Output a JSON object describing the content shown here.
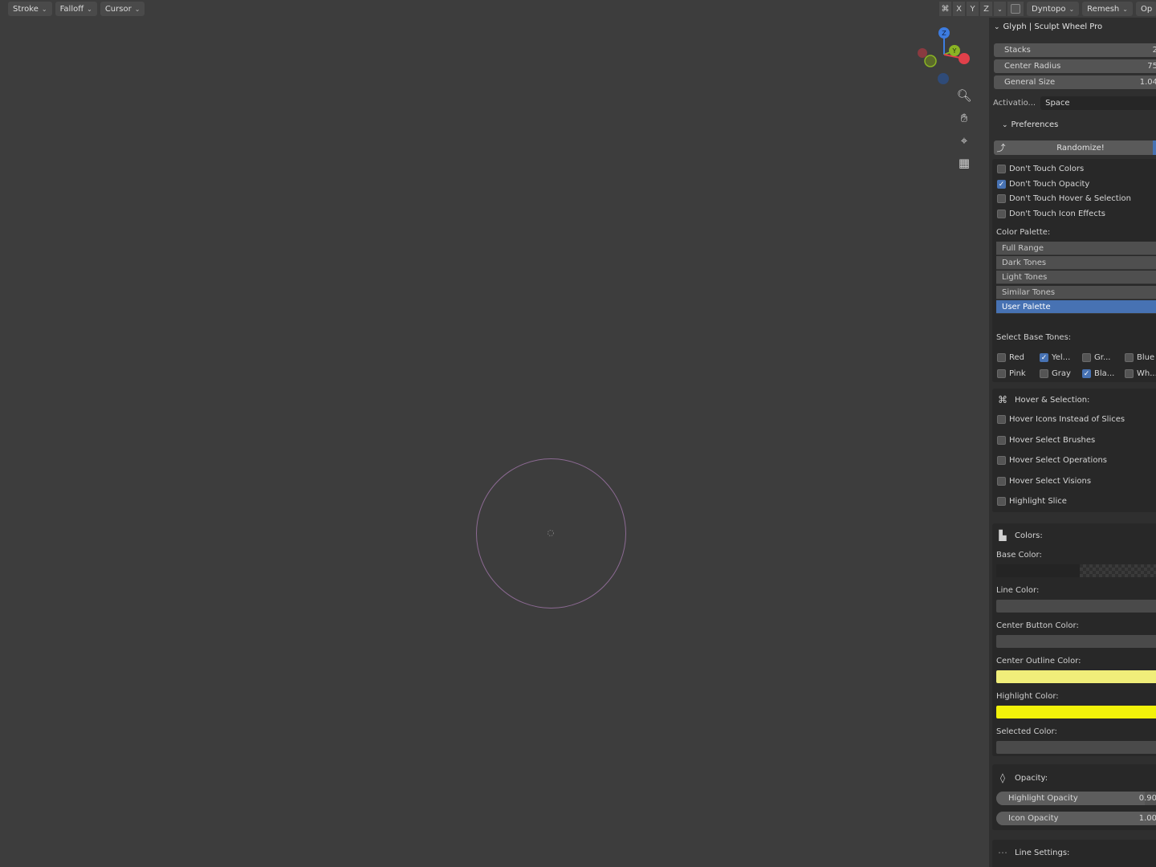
{
  "topbar": {
    "left_buttons": [
      "Stroke",
      "Falloff",
      "Cursor"
    ],
    "axes": [
      "X",
      "Y",
      "Z"
    ],
    "dyntopo": "Dyntopo",
    "remesh": "Remesh",
    "options_partial": "Op"
  },
  "gizmo": {
    "z": "Z",
    "y": "Y"
  },
  "panel": {
    "title": "Glyph | Sculpt Wheel Pro",
    "stacks": {
      "label": "Stacks",
      "value": "2"
    },
    "center_radius": {
      "label": "Center Radius",
      "value": "75"
    },
    "general_size": {
      "label": "General Size",
      "value": "1.04"
    },
    "activation": {
      "label": "Activatio...",
      "value": "Space"
    },
    "preferences": {
      "title": "Preferences",
      "randomize_label": "Randomize!",
      "checks": [
        {
          "label": "Don't Touch Colors",
          "checked": false
        },
        {
          "label": "Don't Touch Opacity",
          "checked": true
        },
        {
          "label": "Don't Touch Hover & Selection",
          "checked": false
        },
        {
          "label": "Don't Touch Icon Effects",
          "checked": false
        }
      ],
      "color_palette_label": "Color Palette:",
      "palette_options": [
        "Full Range",
        "Dark Tones",
        "Light Tones",
        "Similar Tones",
        "User Palette"
      ],
      "palette_selected": "User Palette",
      "base_tones_label": "Select Base Tones:",
      "tones_row1": [
        {
          "label": "Red",
          "checked": false
        },
        {
          "label": "Yel...",
          "checked": true
        },
        {
          "label": "Gr...",
          "checked": false
        },
        {
          "label": "Blue",
          "checked": false
        }
      ],
      "tones_row2": [
        {
          "label": "Pink",
          "checked": false
        },
        {
          "label": "Gray",
          "checked": false
        },
        {
          "label": "Bla...",
          "checked": true
        },
        {
          "label": "Wh...",
          "checked": false
        }
      ]
    },
    "hover": {
      "title": "Hover & Selection:",
      "checks": [
        {
          "label": "Hover Icons Instead of Slices",
          "checked": false
        },
        {
          "label": "Hover Select Brushes",
          "checked": false
        },
        {
          "label": "Hover Select Operations",
          "checked": false
        },
        {
          "label": "Hover Select Visions",
          "checked": false
        },
        {
          "label": "Highlight Slice",
          "checked": false
        }
      ]
    },
    "colors": {
      "title": "Colors:",
      "base_color_label": "Base Color:",
      "line_color_label": "Line Color:",
      "center_button_color_label": "Center Button Color:",
      "center_outline_color_label": "Center Outline Color:",
      "highlight_color_label": "Highlight Color:",
      "selected_color_label": "Selected Color:",
      "line_color": "#4a4a4a",
      "center_button_color": "#4a4a4a",
      "center_outline_color": "#f0ee7a",
      "highlight_color": "#f2f20a",
      "selected_color": "#4a4a4a"
    },
    "opacity": {
      "title": "Opacity:",
      "highlight": {
        "label": "Highlight Opacity",
        "value": "0.90",
        "level": 0.9
      },
      "icon": {
        "label": "Icon Opacity",
        "value": "1.00",
        "level": 1.0
      }
    },
    "line_settings": {
      "title": "Line Settings:"
    }
  }
}
